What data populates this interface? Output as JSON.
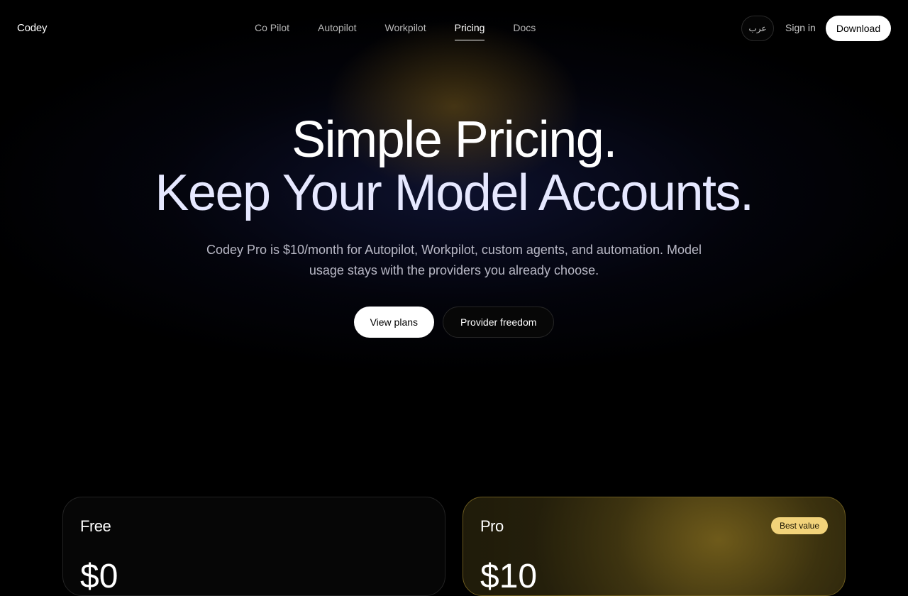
{
  "brand": "Codey",
  "nav": {
    "links": [
      "Co Pilot",
      "Autopilot",
      "Workpilot",
      "Pricing",
      "Docs"
    ],
    "active": "Pricing",
    "lang_label": "عرب",
    "signin_label": "Sign in",
    "download_label": "Download"
  },
  "hero": {
    "title_line1": "Simple Pricing.",
    "title_line2": "Keep Your Model Accounts.",
    "subtitle": "Codey Pro is $10/month for Autopilot, Workpilot, custom agents, and automation. Model usage stays with the providers you already choose.",
    "primary_cta": "View plans",
    "secondary_cta": "Provider freedom"
  },
  "plans": [
    {
      "name": "Free",
      "price": "$0"
    },
    {
      "name": "Pro",
      "price": "$10",
      "badge": "Best value"
    }
  ],
  "colors": {
    "background": "#000000",
    "accent": "#f2d37a",
    "pro_card": "#3b3212"
  }
}
